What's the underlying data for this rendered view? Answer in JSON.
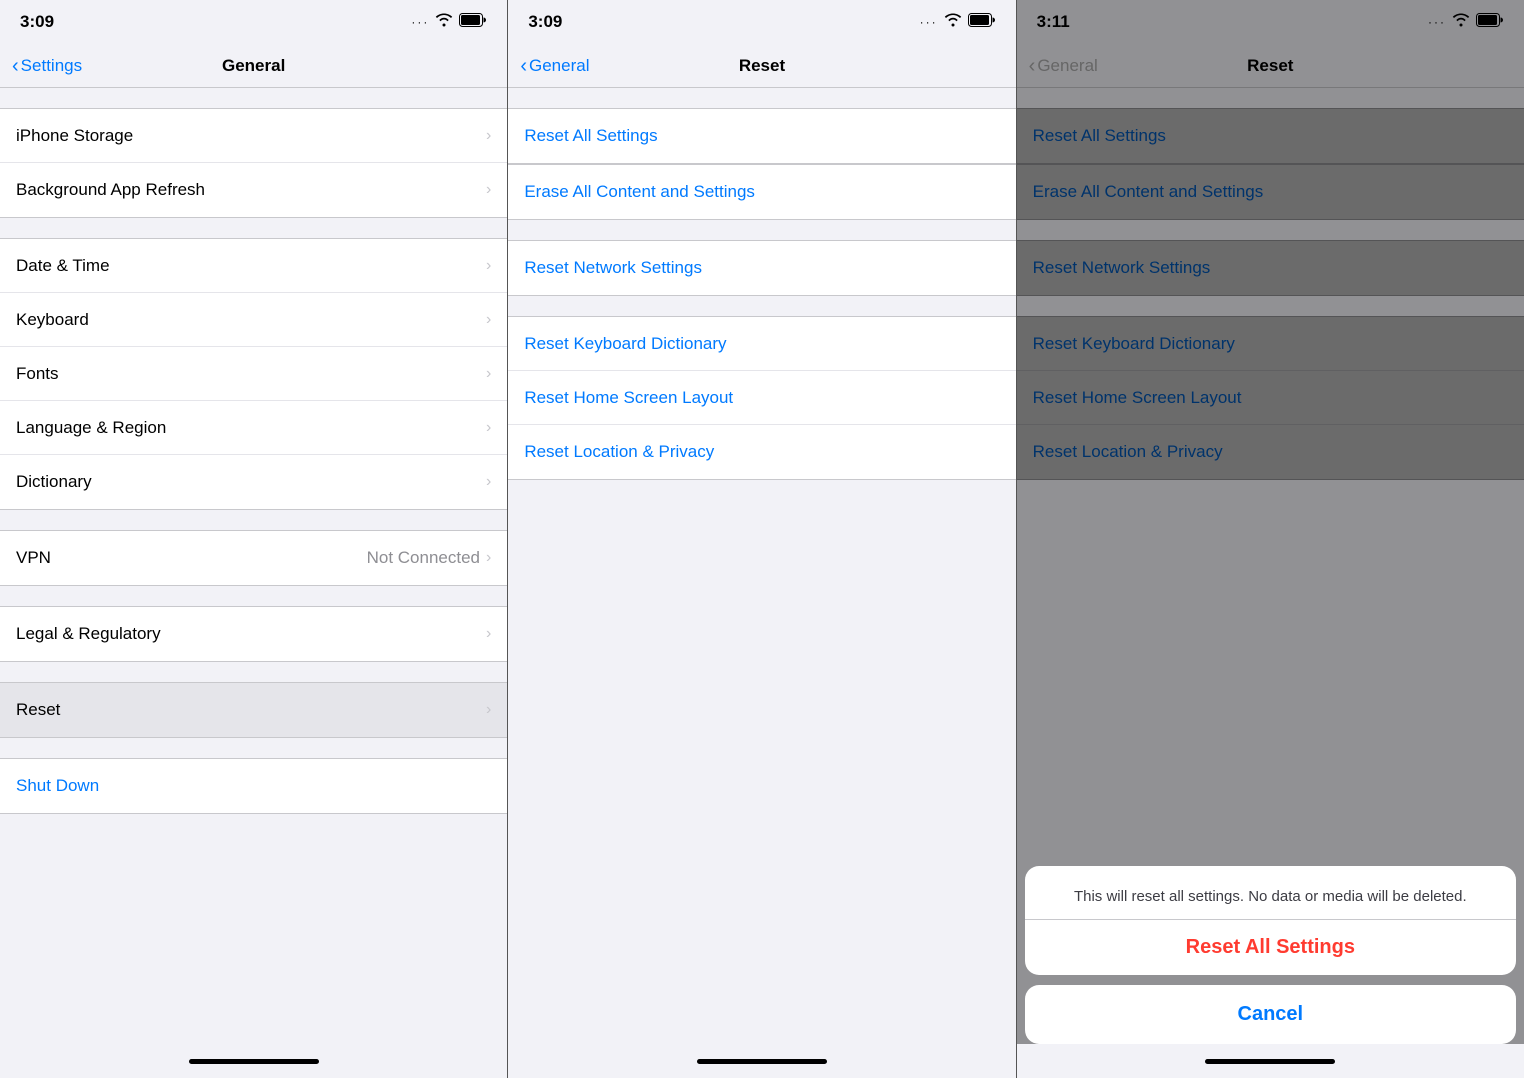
{
  "panel1": {
    "statusBar": {
      "time": "3:09",
      "wifi": "📶",
      "battery": "🔋"
    },
    "navBar": {
      "backLabel": "Settings",
      "title": "General"
    },
    "rows": [
      {
        "label": "iPhone Storage",
        "value": "",
        "hasChevron": true
      },
      {
        "label": "Background App Refresh",
        "value": "",
        "hasChevron": true
      },
      {
        "label": "Date & Time",
        "value": "",
        "hasChevron": true
      },
      {
        "label": "Keyboard",
        "value": "",
        "hasChevron": true
      },
      {
        "label": "Fonts",
        "value": "",
        "hasChevron": true
      },
      {
        "label": "Language & Region",
        "value": "",
        "hasChevron": true
      },
      {
        "label": "Dictionary",
        "value": "",
        "hasChevron": true
      },
      {
        "label": "VPN",
        "value": "Not Connected",
        "hasChevron": true
      },
      {
        "label": "Legal & Regulatory",
        "value": "",
        "hasChevron": true
      },
      {
        "label": "Reset",
        "value": "",
        "hasChevron": true,
        "highlighted": true
      }
    ],
    "shutdownLabel": "Shut Down"
  },
  "panel2": {
    "statusBar": {
      "time": "3:09"
    },
    "navBar": {
      "backLabel": "General",
      "title": "Reset"
    },
    "rows": [
      {
        "label": "Reset All Settings",
        "highlighted": true
      },
      {
        "label": "Erase All Content and Settings"
      },
      {
        "label": "Reset Network Settings"
      },
      {
        "label": "Reset Keyboard Dictionary"
      },
      {
        "label": "Reset Home Screen Layout"
      },
      {
        "label": "Reset Location & Privacy"
      }
    ]
  },
  "panel3": {
    "statusBar": {
      "time": "3:11"
    },
    "navBar": {
      "backLabel": "General",
      "title": "Reset"
    },
    "rows": [
      {
        "label": "Reset All Settings"
      },
      {
        "label": "Erase All Content and Settings"
      },
      {
        "label": "Reset Network Settings"
      },
      {
        "label": "Reset Keyboard Dictionary"
      },
      {
        "label": "Reset Home Screen Layout"
      },
      {
        "label": "Reset Location & Privacy"
      }
    ],
    "dialog": {
      "message": "This will reset all settings. No data or media will be deleted.",
      "actionLabel": "Reset All Settings",
      "cancelLabel": "Cancel"
    }
  },
  "icons": {
    "chevronLeft": "‹",
    "chevronRight": "›",
    "wifi": "wifi",
    "battery": "battery"
  }
}
